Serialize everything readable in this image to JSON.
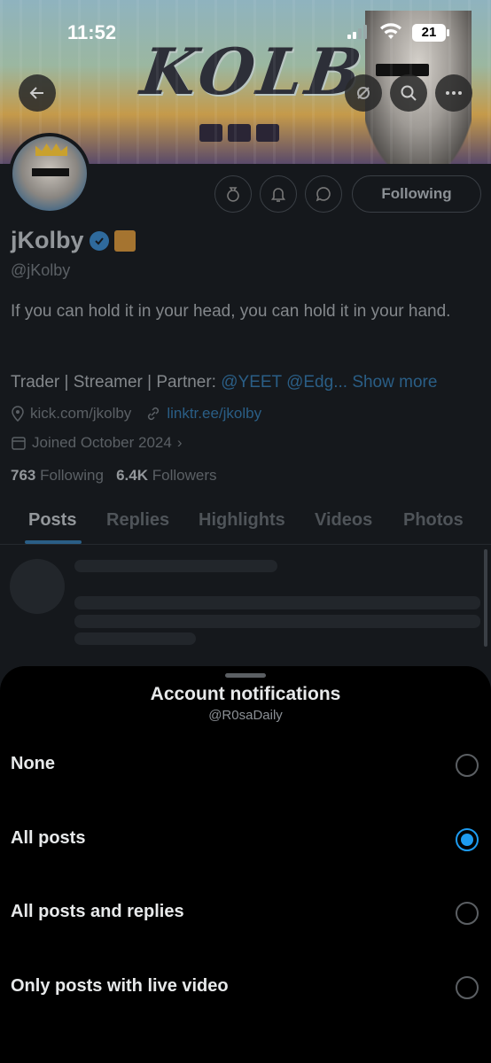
{
  "status_bar": {
    "time": "11:52",
    "battery": "21"
  },
  "banner": {
    "title_text": "KOLBY"
  },
  "profile": {
    "following_label": "Following",
    "name": "jKolby",
    "handle": "@jKolby",
    "bio_line1": "If you can hold it in your head, you can hold it in your hand.",
    "bio_line2_prefix": "Trader | Streamer | Partner: ",
    "bio_line2_mentions": "@YEET @Edg...",
    "show_more": "Show more",
    "location": "kick.com/jkolby",
    "website": "linktr.ee/jkolby",
    "joined": "Joined October 2024",
    "following_count": "763",
    "following_text": "Following",
    "followers_count": "6.4K",
    "followers_text": "Followers"
  },
  "tabs": [
    {
      "label": "Posts"
    },
    {
      "label": "Replies"
    },
    {
      "label": "Highlights"
    },
    {
      "label": "Videos"
    },
    {
      "label": "Photos"
    }
  ],
  "sheet": {
    "title": "Account notifications",
    "subtitle": "@R0saDaily",
    "options": [
      {
        "label": "None",
        "selected": false
      },
      {
        "label": "All posts",
        "selected": true
      },
      {
        "label": "All posts and replies",
        "selected": false
      },
      {
        "label": "Only posts with live video",
        "selected": false
      }
    ]
  },
  "colors": {
    "accent": "#1d9bf0",
    "sheet_bg": "#000000",
    "dim_bg": "#15181c"
  }
}
